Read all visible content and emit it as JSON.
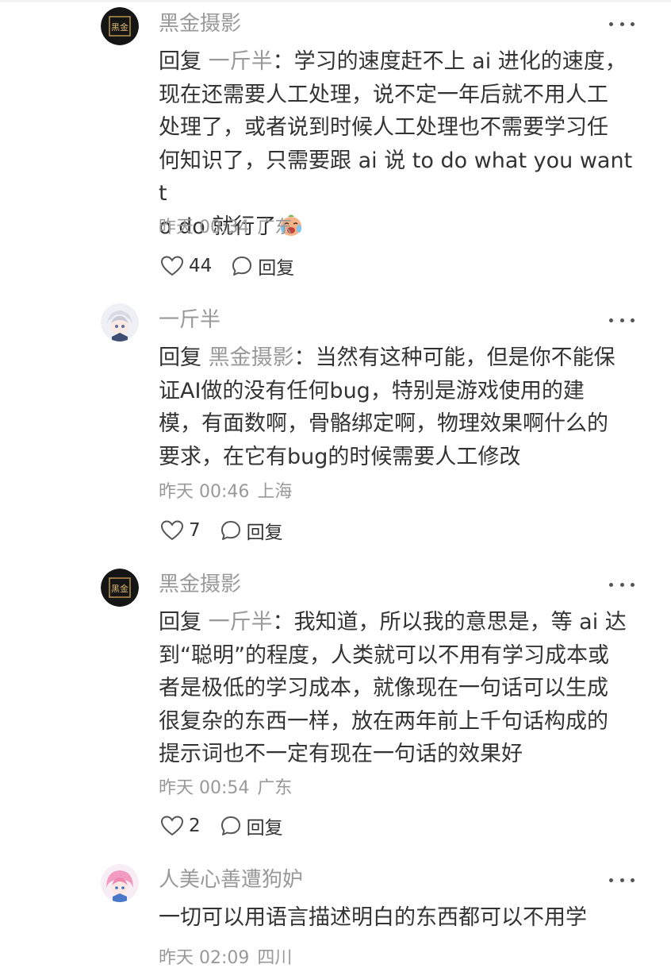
{
  "comments": [
    {
      "username": "黑金摄影",
      "avatar_text": "黑金",
      "reply_prefix": "回复 ",
      "reply_target": "一斤半",
      "text_lines": [
        "：学习的速度赶不上 ai 进化的速度，",
        "现在还需要人工处理，说不定一年后就不用人工",
        "处理了，或者说到时候人工处理也不需要学习任",
        "何知识了，只需要跟 ai 说 to do what you want t",
        "o do 就行了"
      ],
      "emoji": "crying-laughing-emoji",
      "time": "昨天 00:34",
      "location": "广东",
      "likes": "44",
      "reply_label": "回复"
    },
    {
      "username": "一斤半",
      "avatar_text": "",
      "reply_prefix": "回复 ",
      "reply_target": "黑金摄影",
      "text_lines": [
        "：当然有这种可能，但是你不能保",
        "证AI做的没有任何bug，特别是游戏使用的建",
        "模，有面数啊，骨骼绑定啊，物理效果啊什么的",
        "要求，在它有bug的时候需要人工修改"
      ],
      "emoji": "",
      "time": "昨天 00:46",
      "location": "上海",
      "likes": "7",
      "reply_label": "回复"
    },
    {
      "username": "黑金摄影",
      "avatar_text": "黑金",
      "reply_prefix": "回复 ",
      "reply_target": "一斤半",
      "text_lines": [
        "：我知道，所以我的意思是，等 ai 达",
        "到“聪明”的程度，人类就可以不用有学习成本或",
        "者是极低的学习成本，就像现在一句话可以生成",
        "很复杂的东西一样，放在两年前上千句话构成的",
        "提示词也不一定有现在一句话的效果好"
      ],
      "emoji": "",
      "time": "昨天 00:54",
      "location": "广东",
      "likes": "2",
      "reply_label": "回复"
    },
    {
      "username": "人美心善遭狗妒",
      "avatar_text": "",
      "reply_prefix": "",
      "reply_target": "",
      "text_lines": [
        "一切可以用语言描述明白的东西都可以不用学"
      ],
      "emoji": "",
      "time": "昨天 02:09",
      "location": "四川",
      "likes": "",
      "reply_label": ""
    }
  ],
  "colors": {
    "primary_text": "#333333",
    "secondary_text": "#999999",
    "icon": "#555555"
  }
}
